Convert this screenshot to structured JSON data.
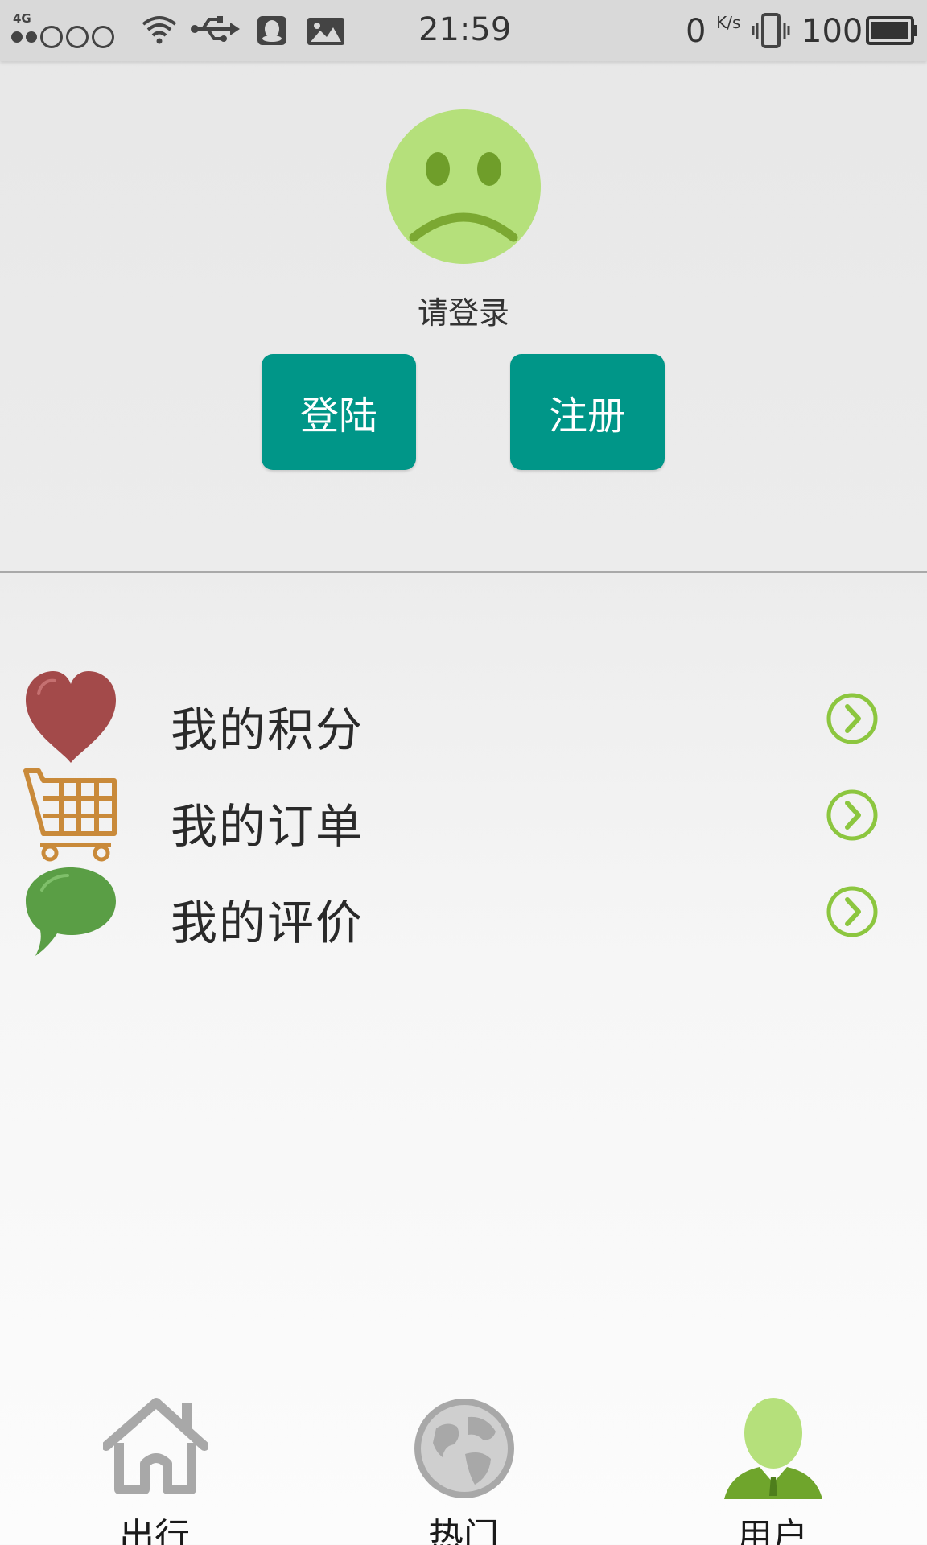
{
  "status_bar": {
    "network": "4G",
    "time": "21:59",
    "speed_value": "0",
    "speed_unit": "K/s",
    "battery": "100"
  },
  "profile": {
    "prompt": "请登录",
    "login_label": "登陆",
    "register_label": "注册"
  },
  "menu": {
    "items": [
      {
        "label": "我的积分",
        "icon": "heart-icon"
      },
      {
        "label": "我的订单",
        "icon": "shopping-cart-icon"
      },
      {
        "label": "我的评价",
        "icon": "speech-bubble-icon"
      }
    ]
  },
  "bottom_nav": {
    "tabs": [
      {
        "label": "出行",
        "icon": "home-icon",
        "active": false
      },
      {
        "label": "热门",
        "icon": "globe-icon",
        "active": false
      },
      {
        "label": "用户",
        "icon": "user-icon",
        "active": true
      }
    ]
  },
  "colors": {
    "accent": "#009688",
    "avatar": "#b5e07b",
    "heart": "#a34a4a",
    "cart": "#c98a3a",
    "bubble": "#5a9e45",
    "chevron": "#8cc63f"
  }
}
